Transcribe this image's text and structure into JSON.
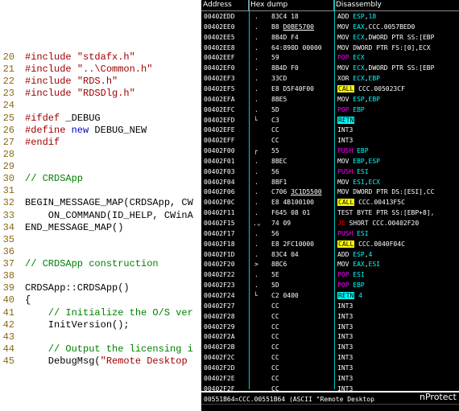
{
  "source": {
    "lines": [
      {
        "n": "20",
        "parts": [
          [
            "pp",
            "#include "
          ],
          [
            "str",
            "\"stdafx.h\""
          ]
        ]
      },
      {
        "n": "21",
        "parts": [
          [
            "pp",
            "#include "
          ],
          [
            "str",
            "\"..\\Common.h\""
          ]
        ]
      },
      {
        "n": "22",
        "parts": [
          [
            "pp",
            "#include "
          ],
          [
            "str",
            "\"RDS.h\""
          ]
        ]
      },
      {
        "n": "23",
        "parts": [
          [
            "pp",
            "#include "
          ],
          [
            "str",
            "\"RDSDlg.h\""
          ]
        ]
      },
      {
        "n": "24",
        "parts": []
      },
      {
        "n": "25",
        "parts": [
          [
            "pp",
            "#ifdef "
          ],
          [
            "tx",
            "_DEBUG"
          ]
        ]
      },
      {
        "n": "26",
        "parts": [
          [
            "pp",
            "#define "
          ],
          [
            "kw",
            "new "
          ],
          [
            "tx",
            "DEBUG_NEW"
          ]
        ]
      },
      {
        "n": "27",
        "parts": [
          [
            "pp",
            "#endif"
          ]
        ]
      },
      {
        "n": "28",
        "parts": []
      },
      {
        "n": "29",
        "parts": []
      },
      {
        "n": "30",
        "parts": [
          [
            "cm",
            "// CRDSApp"
          ]
        ]
      },
      {
        "n": "31",
        "parts": []
      },
      {
        "n": "32",
        "parts": [
          [
            "tx",
            "BEGIN_MESSAGE_MAP(CRDSApp, CW"
          ]
        ]
      },
      {
        "n": "33",
        "parts": [
          [
            "tx",
            "    ON_COMMAND(ID_HELP, CWinA"
          ]
        ]
      },
      {
        "n": "34",
        "parts": [
          [
            "tx",
            "END_MESSAGE_MAP()"
          ]
        ]
      },
      {
        "n": "35",
        "parts": []
      },
      {
        "n": "36",
        "parts": []
      },
      {
        "n": "37",
        "parts": [
          [
            "cm",
            "// CRDSApp construction"
          ]
        ]
      },
      {
        "n": "38",
        "parts": []
      },
      {
        "n": "39",
        "parts": [
          [
            "tx",
            "CRDSApp::CRDSApp()"
          ]
        ]
      },
      {
        "n": "40",
        "parts": [
          [
            "tx",
            "{"
          ]
        ]
      },
      {
        "n": "41",
        "parts": [
          [
            "cm",
            "    // Initialize the O/S ver"
          ]
        ]
      },
      {
        "n": "42",
        "parts": [
          [
            "tx",
            "    InitVersion();"
          ]
        ]
      },
      {
        "n": "43",
        "parts": []
      },
      {
        "n": "44",
        "parts": [
          [
            "cm",
            "    // Output the licensing i"
          ]
        ]
      },
      {
        "n": "45",
        "parts": [
          [
            "tx",
            "    DebugMsg("
          ],
          [
            "str",
            "\"Remote Desktop"
          ]
        ]
      }
    ]
  },
  "debugger": {
    "headers": {
      "address": "Address",
      "hex": "Hex dump",
      "disasm": "Disassembly"
    },
    "rows": [
      {
        "addr": "00402EDD",
        "g": ".",
        "hex": [
          [
            "",
            "83C4 18"
          ]
        ],
        "dis": [
          [
            "",
            "ADD "
          ],
          [
            "reg",
            "ESP"
          ],
          [
            "",
            ","
          ],
          [
            "reg",
            "18"
          ]
        ]
      },
      {
        "addr": "00402EE0",
        "g": ".",
        "hex": [
          [
            "",
            "B8 "
          ],
          [
            "u",
            "D0BE5700"
          ]
        ],
        "dis": [
          [
            "",
            "MOV "
          ],
          [
            "reg",
            "EAX"
          ],
          [
            "",
            ",CCC.0057BED0"
          ]
        ]
      },
      {
        "addr": "00402EE5",
        "g": ".",
        "hex": [
          [
            "",
            "8B4D F4"
          ]
        ],
        "dis": [
          [
            "",
            "MOV "
          ],
          [
            "reg",
            "ECX"
          ],
          [
            "",
            ",DWORD PTR SS:[EBP"
          ]
        ]
      },
      {
        "addr": "00402EE8",
        "g": ".",
        "hex": [
          [
            "",
            "64:890D 00000"
          ]
        ],
        "dis": [
          [
            "",
            "MOV DWORD PTR FS:[0],ECX"
          ]
        ]
      },
      {
        "addr": "00402EEF",
        "g": ".",
        "hex": [
          [
            "",
            "59"
          ]
        ],
        "dis": [
          [
            "push",
            "POP "
          ],
          [
            "reg",
            "ECX"
          ]
        ]
      },
      {
        "addr": "00402EF0",
        "g": ".",
        "hex": [
          [
            "",
            "8B4D F0"
          ]
        ],
        "dis": [
          [
            "",
            "MOV "
          ],
          [
            "reg",
            "ECX"
          ],
          [
            "",
            ",DWORD PTR SS:[EBP"
          ]
        ]
      },
      {
        "addr": "00402EF3",
        "g": ".",
        "hex": [
          [
            "",
            "33CD"
          ]
        ],
        "dis": [
          [
            "",
            "XOR "
          ],
          [
            "reg",
            "ECX"
          ],
          [
            "",
            ","
          ],
          [
            "reg",
            "EBP"
          ]
        ]
      },
      {
        "addr": "00402EF5",
        "g": ".",
        "hex": [
          [
            "",
            "E8 D5F40F00"
          ]
        ],
        "dis": [
          [
            "call",
            "CALL"
          ],
          [
            "",
            " CCC.005023CF"
          ]
        ]
      },
      {
        "addr": "00402EFA",
        "g": ".",
        "hex": [
          [
            "",
            "8BE5"
          ]
        ],
        "dis": [
          [
            "",
            "MOV "
          ],
          [
            "reg",
            "ESP"
          ],
          [
            "",
            ","
          ],
          [
            "reg",
            "EBP"
          ]
        ]
      },
      {
        "addr": "00402EFC",
        "g": ".",
        "hex": [
          [
            "",
            "5D"
          ]
        ],
        "dis": [
          [
            "push",
            "POP "
          ],
          [
            "reg",
            "EBP"
          ]
        ]
      },
      {
        "addr": "00402EFD",
        "g": "L",
        "hex": [
          [
            "",
            "C3"
          ]
        ],
        "dis": [
          [
            "retn",
            "RETN"
          ]
        ]
      },
      {
        "addr": "00402EFE",
        "g": "",
        "hex": [
          [
            "",
            "CC"
          ]
        ],
        "dis": [
          [
            "",
            "INT3"
          ]
        ]
      },
      {
        "addr": "00402EFF",
        "g": "",
        "hex": [
          [
            "",
            "CC"
          ]
        ],
        "dis": [
          [
            "",
            "INT3"
          ]
        ]
      },
      {
        "addr": "00402F00",
        "g": "r",
        "hex": [
          [
            "",
            "55"
          ]
        ],
        "dis": [
          [
            "push",
            "PUSH "
          ],
          [
            "reg",
            "EBP"
          ]
        ]
      },
      {
        "addr": "00402F01",
        "g": ".",
        "hex": [
          [
            "",
            "8BEC"
          ]
        ],
        "dis": [
          [
            "",
            "MOV "
          ],
          [
            "reg",
            "EBP"
          ],
          [
            "",
            ","
          ],
          [
            "reg",
            "ESP"
          ]
        ]
      },
      {
        "addr": "00402F03",
        "g": ".",
        "hex": [
          [
            "",
            "56"
          ]
        ],
        "dis": [
          [
            "push",
            "PUSH "
          ],
          [
            "reg",
            "ESI"
          ]
        ]
      },
      {
        "addr": "00402F04",
        "g": ".",
        "hex": [
          [
            "",
            "8BF1"
          ]
        ],
        "dis": [
          [
            "",
            "MOV "
          ],
          [
            "reg",
            "ESI"
          ],
          [
            "",
            ","
          ],
          [
            "reg",
            "ECX"
          ]
        ]
      },
      {
        "addr": "00402F06",
        "g": ".",
        "hex": [
          [
            "",
            "C706 "
          ],
          [
            "u",
            "3C1D5500"
          ]
        ],
        "dis": [
          [
            "",
            "MOV DWORD PTR DS:[ESI],CC"
          ]
        ]
      },
      {
        "addr": "00402F0C",
        "g": ".",
        "hex": [
          [
            "",
            "E8 4B100100"
          ]
        ],
        "dis": [
          [
            "call",
            "CALL"
          ],
          [
            "",
            " CCC.00413F5C"
          ]
        ]
      },
      {
        "addr": "00402F11",
        "g": ".",
        "hex": [
          [
            "",
            "F645 08 01"
          ]
        ],
        "dis": [
          [
            "",
            "TEST BYTE PTR SS:[EBP+8],"
          ]
        ]
      },
      {
        "addr": "00402F15",
        "g": "v",
        "hex": [
          [
            "",
            "74 09"
          ]
        ],
        "dis": [
          [
            "je",
            "JE"
          ],
          [
            "",
            " SHORT CCC.00402F20"
          ]
        ]
      },
      {
        "addr": "00402F17",
        "g": ".",
        "hex": [
          [
            "",
            "56"
          ]
        ],
        "dis": [
          [
            "push",
            "PUSH "
          ],
          [
            "reg",
            "ESI"
          ]
        ]
      },
      {
        "addr": "00402F18",
        "g": ".",
        "hex": [
          [
            "",
            "E8 2FC10000"
          ]
        ],
        "dis": [
          [
            "call",
            "CALL"
          ],
          [
            "",
            " CCC.0040F04C"
          ]
        ]
      },
      {
        "addr": "00402F1D",
        "g": ".",
        "hex": [
          [
            "",
            "83C4 04"
          ]
        ],
        "dis": [
          [
            "",
            "ADD "
          ],
          [
            "reg",
            "ESP"
          ],
          [
            "",
            ","
          ],
          [
            "reg",
            "4"
          ]
        ]
      },
      {
        "addr": "00402F20",
        "g": ">",
        "hex": [
          [
            "",
            "8BC6"
          ]
        ],
        "dis": [
          [
            "",
            "MOV "
          ],
          [
            "reg",
            "EAX"
          ],
          [
            "",
            ","
          ],
          [
            "reg",
            "ESI"
          ]
        ]
      },
      {
        "addr": "00402F22",
        "g": ".",
        "hex": [
          [
            "",
            "5E"
          ]
        ],
        "dis": [
          [
            "push",
            "POP "
          ],
          [
            "reg",
            "ESI"
          ]
        ]
      },
      {
        "addr": "00402F23",
        "g": ".",
        "hex": [
          [
            "",
            "5D"
          ]
        ],
        "dis": [
          [
            "push",
            "POP "
          ],
          [
            "reg",
            "EBP"
          ]
        ]
      },
      {
        "addr": "00402F24",
        "g": "L",
        "hex": [
          [
            "",
            "C2 0400"
          ]
        ],
        "dis": [
          [
            "retn",
            "RETN"
          ],
          [
            "reg",
            " 4"
          ]
        ]
      },
      {
        "addr": "00402F27",
        "g": "",
        "hex": [
          [
            "",
            "CC"
          ]
        ],
        "dis": [
          [
            "",
            "INT3"
          ]
        ]
      },
      {
        "addr": "00402F28",
        "g": "",
        "hex": [
          [
            "",
            "CC"
          ]
        ],
        "dis": [
          [
            "",
            "INT3"
          ]
        ]
      },
      {
        "addr": "00402F29",
        "g": "",
        "hex": [
          [
            "",
            "CC"
          ]
        ],
        "dis": [
          [
            "",
            "INT3"
          ]
        ]
      },
      {
        "addr": "00402F2A",
        "g": "",
        "hex": [
          [
            "",
            "CC"
          ]
        ],
        "dis": [
          [
            "",
            "INT3"
          ]
        ]
      },
      {
        "addr": "00402F2B",
        "g": "",
        "hex": [
          [
            "",
            "CC"
          ]
        ],
        "dis": [
          [
            "",
            "INT3"
          ]
        ]
      },
      {
        "addr": "00402F2C",
        "g": "",
        "hex": [
          [
            "",
            "CC"
          ]
        ],
        "dis": [
          [
            "",
            "INT3"
          ]
        ]
      },
      {
        "addr": "00402F2D",
        "g": "",
        "hex": [
          [
            "",
            "CC"
          ]
        ],
        "dis": [
          [
            "",
            "INT3"
          ]
        ]
      },
      {
        "addr": "00402F2E",
        "g": "",
        "hex": [
          [
            "",
            "CC"
          ]
        ],
        "dis": [
          [
            "",
            "INT3"
          ]
        ]
      },
      {
        "addr": "00402F2F",
        "g": "",
        "hex": [
          [
            "",
            "CC"
          ]
        ],
        "dis": [
          [
            "",
            "INT3"
          ]
        ]
      }
    ],
    "status": "00551B64=CCC.00551B64 (ASCII \"Remote Desktop",
    "brand": "nProtect"
  },
  "colors": {
    "accent_cyan": "#00ffff",
    "call_yellow": "#ffff00",
    "push_magenta": "#ff00ff",
    "jump_red": "#ff0000",
    "comment_green": "#008000",
    "directive_red": "#a00000",
    "keyword_blue": "#0000c0",
    "line_number": "#8b6914"
  }
}
